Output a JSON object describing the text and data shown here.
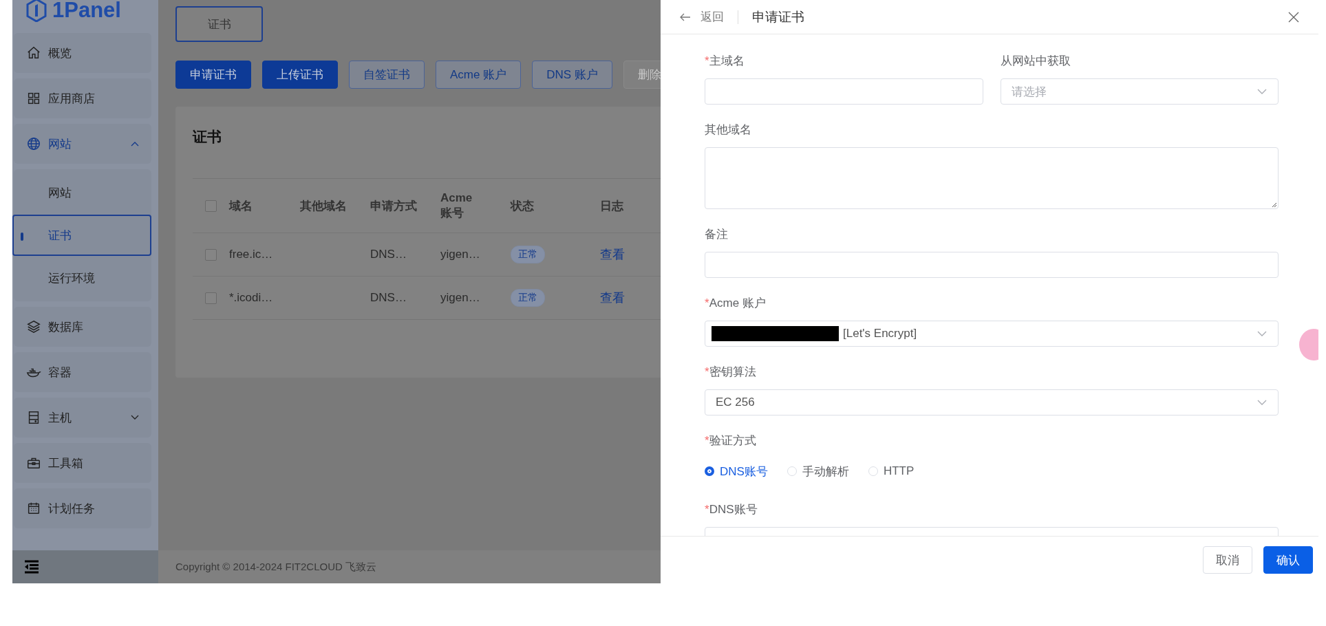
{
  "sidebar": {
    "logo": "1Panel",
    "items": [
      {
        "label": "概览",
        "kind": "link",
        "selected": false
      },
      {
        "label": "应用商店",
        "kind": "link",
        "selected": false
      },
      {
        "label": "网站",
        "kind": "group",
        "expanded": true,
        "selected": false,
        "children": [
          {
            "label": "网站",
            "selected": false
          },
          {
            "label": "证书",
            "selected": true
          },
          {
            "label": "运行环境",
            "selected": false
          }
        ]
      },
      {
        "label": "数据库",
        "kind": "link",
        "selected": false
      },
      {
        "label": "容器",
        "kind": "link",
        "selected": false
      },
      {
        "label": "主机",
        "kind": "group",
        "expanded": false,
        "selected": false
      },
      {
        "label": "工具箱",
        "kind": "link",
        "selected": false
      },
      {
        "label": "计划任务",
        "kind": "link",
        "selected": false
      }
    ]
  },
  "tabs": [
    {
      "label": "证书",
      "selected": true
    }
  ],
  "toolbar": [
    {
      "label": "申请证书",
      "kind": "primary",
      "disabled": false
    },
    {
      "label": "上传证书",
      "kind": "primary",
      "disabled": false
    },
    {
      "label": "自签证书",
      "kind": "outline",
      "disabled": false
    },
    {
      "label": "Acme 账户",
      "kind": "outline",
      "disabled": false
    },
    {
      "label": "DNS 账户",
      "kind": "outline",
      "disabled": false
    },
    {
      "label": "删除",
      "kind": "outline",
      "disabled": true
    }
  ],
  "card": {
    "title": "证书",
    "table": {
      "all_checked": false,
      "columns": [
        "域名",
        "其他域名",
        "申请方式",
        "Acme 账号",
        "状态",
        "日志"
      ],
      "rows": [
        {
          "checked": false,
          "domain": "free.ic…",
          "method": "DNS…",
          "acme": "yigen…",
          "status": "正常",
          "log": "查看"
        },
        {
          "checked": false,
          "domain": "*.icodi…",
          "method": "DNS…",
          "acme": "yigen…",
          "status": "正常",
          "log": "查看"
        }
      ]
    }
  },
  "footer": "Copyright © 2014-2024 FIT2CLOUD 飞致云",
  "drawer": {
    "back": "返回",
    "title": "申请证书",
    "rows": [
      [
        {
          "kind": "input",
          "label": "主域名",
          "required_mark": "*"
        },
        {
          "kind": "select",
          "label": "从网站中获取",
          "placeholder": "请选择"
        }
      ],
      [
        {
          "kind": "textarea",
          "label": "其他域名"
        }
      ],
      [
        {
          "kind": "input",
          "label": "备注"
        }
      ],
      [
        {
          "kind": "select",
          "label": "Acme 账户",
          "required_mark": "*",
          "redacted": true,
          "value": "[Let's Encrypt]"
        }
      ],
      [
        {
          "kind": "select",
          "label": "密钥算法",
          "required_mark": "*",
          "value": "EC 256"
        }
      ],
      [
        {
          "kind": "radio",
          "label": "验证方式",
          "required_mark": "*",
          "options": [
            {
              "label": "DNS账号",
              "selected": true
            },
            {
              "label": "手动解析",
              "selected": false
            },
            {
              "label": "HTTP",
              "selected": false
            }
          ]
        }
      ],
      [
        {
          "kind": "input",
          "label": "DNS账号",
          "required_mark": "*"
        }
      ]
    ],
    "buttons": [
      {
        "label": "取消",
        "kind": "plain"
      },
      {
        "label": "确认",
        "kind": "primary"
      }
    ]
  }
}
